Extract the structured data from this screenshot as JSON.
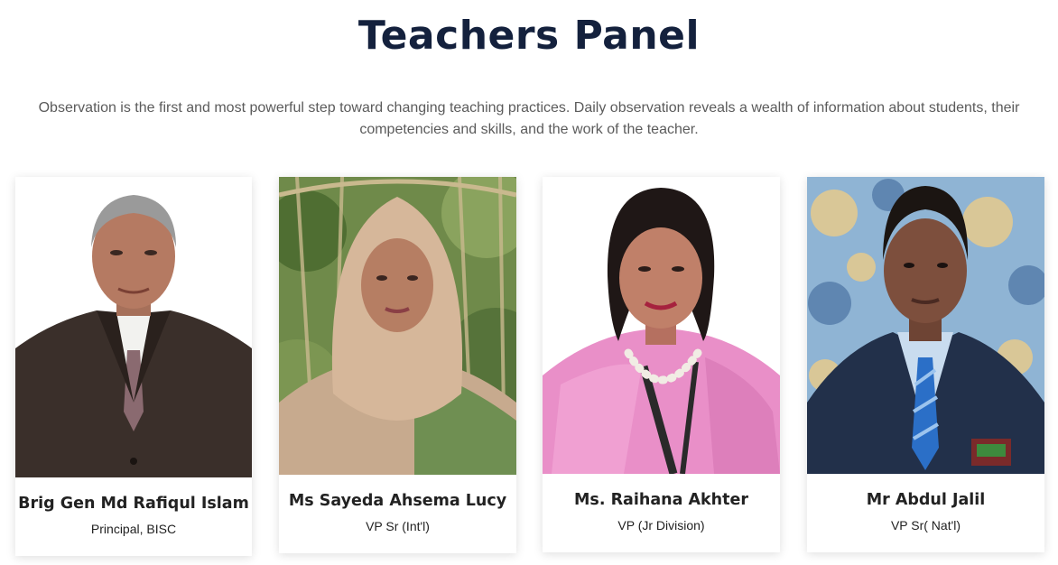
{
  "section": {
    "title": "Teachers Panel",
    "intro": "Observation is the first and most powerful step toward changing teaching practices. Daily observation reveals a wealth of information about students, their competencies and skills, and the work of the teacher."
  },
  "teachers": [
    {
      "name": "Brig Gen Md Rafiqul Islam",
      "role": "Principal, BISC"
    },
    {
      "name": "Ms Sayeda Ahsema Lucy",
      "role": "VP Sr (Int'l)"
    },
    {
      "name": "Ms. Raihana Akhter",
      "role": "VP (Jr Division)"
    },
    {
      "name": "Mr Abdul Jalil",
      "role": "VP Sr( Nat'l)"
    }
  ],
  "colors": {
    "title": "#14213d",
    "intro_text": "#5b5b5b",
    "card_text": "#222222",
    "card_bg": "#ffffff"
  }
}
